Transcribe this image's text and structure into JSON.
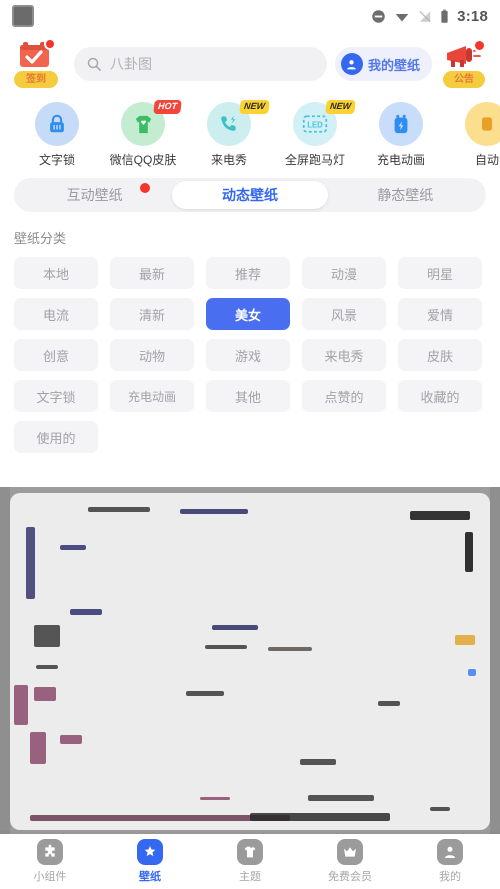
{
  "statusbar": {
    "app_icon": "app-square-icon",
    "icons": [
      "do-not-disturb-icon",
      "wifi-icon",
      "signal-off-icon",
      "battery-icon"
    ],
    "time": "3:18"
  },
  "header": {
    "checkin": {
      "label": "签到",
      "icon": "calendar-check-icon",
      "has_dot": true
    },
    "search": {
      "placeholder": "八卦图",
      "icon": "search-icon"
    },
    "my_wallpaper": {
      "label": "我的壁纸",
      "icon": "user-avatar-icon"
    },
    "announcement": {
      "label": "公告",
      "icon": "megaphone-icon",
      "has_dot": true
    }
  },
  "features": [
    {
      "label": "文字锁",
      "icon": "lock-icon",
      "circle": "#c6dbf8",
      "fg": "#2e8ef0",
      "badge": ""
    },
    {
      "label": "微信QQ皮肤",
      "icon": "tshirt-icon",
      "circle": "#c4ecd1",
      "fg": "#3bbd63",
      "badge": "HOT"
    },
    {
      "label": "来电秀",
      "icon": "phone-icon",
      "circle": "#cdeeee",
      "fg": "#3fc0c6",
      "badge": "NEW"
    },
    {
      "label": "全屏跑马灯",
      "icon": "led-icon",
      "circle": "#d4f0f7",
      "fg": "#49c4e0",
      "badge": "NEW"
    },
    {
      "label": "充电动画",
      "icon": "battery-charge-icon",
      "circle": "#c8ddfa",
      "fg": "#2e8ef0",
      "badge": ""
    },
    {
      "label": "自动",
      "icon": "auto-icon",
      "circle": "#fbdf8f",
      "fg": "#e9a024",
      "badge": ""
    }
  ],
  "tabs": [
    {
      "label": "互动壁纸",
      "active": false,
      "dot": true
    },
    {
      "label": "动态壁纸",
      "active": true,
      "dot": false
    },
    {
      "label": "静态壁纸",
      "active": false,
      "dot": false
    }
  ],
  "categories": {
    "title": "壁纸分类",
    "items": [
      {
        "label": "本地",
        "selected": false
      },
      {
        "label": "最新",
        "selected": false
      },
      {
        "label": "推荐",
        "selected": false
      },
      {
        "label": "动漫",
        "selected": false
      },
      {
        "label": "明星",
        "selected": false
      },
      {
        "label": "电流",
        "selected": false
      },
      {
        "label": "清新",
        "selected": false
      },
      {
        "label": "美女",
        "selected": true
      },
      {
        "label": "风景",
        "selected": false
      },
      {
        "label": "爱情",
        "selected": false
      },
      {
        "label": "创意",
        "selected": false
      },
      {
        "label": "动物",
        "selected": false
      },
      {
        "label": "游戏",
        "selected": false
      },
      {
        "label": "来电秀",
        "selected": false
      },
      {
        "label": "皮肤",
        "selected": false
      },
      {
        "label": "文字锁",
        "selected": false
      },
      {
        "label": "充电动画",
        "selected": false
      },
      {
        "label": "其他",
        "selected": false
      },
      {
        "label": "点赞的",
        "selected": false
      },
      {
        "label": "收藏的",
        "selected": false
      },
      {
        "label": "使用的",
        "selected": false
      }
    ]
  },
  "bottom_nav": [
    {
      "label": "小组件",
      "icon": "puzzle-icon",
      "active": false
    },
    {
      "label": "壁纸",
      "icon": "sparkle-icon",
      "active": true
    },
    {
      "label": "主题",
      "icon": "shirt-icon",
      "active": false
    },
    {
      "label": "免费会员",
      "icon": "crown-icon",
      "active": false
    },
    {
      "label": "我的",
      "icon": "person-icon",
      "active": false
    }
  ],
  "colors": {
    "accent_blue": "#3568f0",
    "chip_selected": "#4a6ef0",
    "badge_yellow": "#f5cc3e",
    "badge_red": "#f4453a"
  }
}
